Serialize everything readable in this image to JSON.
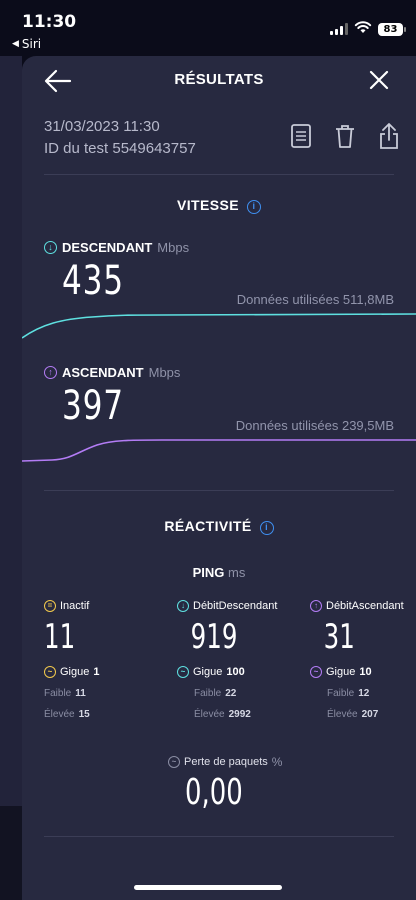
{
  "status": {
    "time": "11:30",
    "back_app": "Siri",
    "battery": "83"
  },
  "header": {
    "title": "RÉSULTATS"
  },
  "meta": {
    "date": "31/03/2023 11:30",
    "test_id": "ID du test 5549643757"
  },
  "speed": {
    "title": "VITESSE",
    "download": {
      "label": "DESCENDANT",
      "unit": "Mbps",
      "value": "435",
      "data_used": "Données utilisées 511,8MB",
      "color": "#5ee0e0"
    },
    "upload": {
      "label": "ASCENDANT",
      "unit": "Mbps",
      "value": "397",
      "data_used": "Données utilisées 239,5MB",
      "color": "#b37cf5"
    }
  },
  "reactivity": {
    "title": "RÉACTIVITÉ",
    "ping_label": "PING",
    "ping_unit": "ms",
    "columns": [
      {
        "label": "Inactif",
        "value": "11",
        "jitter_label": "Gigue",
        "jitter": "1",
        "low_label": "Faible",
        "low": "11",
        "high_label": "Élevée",
        "high": "15",
        "color": "#f2c94c"
      },
      {
        "label": "DébitDescendant",
        "value": "919",
        "jitter_label": "Gigue",
        "jitter": "100",
        "low_label": "Faible",
        "low": "22",
        "high_label": "Élevée",
        "high": "2992",
        "color": "#5ee0e0"
      },
      {
        "label": "DébitAscendant",
        "value": "31",
        "jitter_label": "Gigue",
        "jitter": "10",
        "low_label": "Faible",
        "low": "12",
        "high_label": "Élevée",
        "high": "207",
        "color": "#b37cf5"
      }
    ],
    "packet_loss_label": "Perte de paquets",
    "packet_loss_unit": "%",
    "packet_loss": "0,00"
  }
}
